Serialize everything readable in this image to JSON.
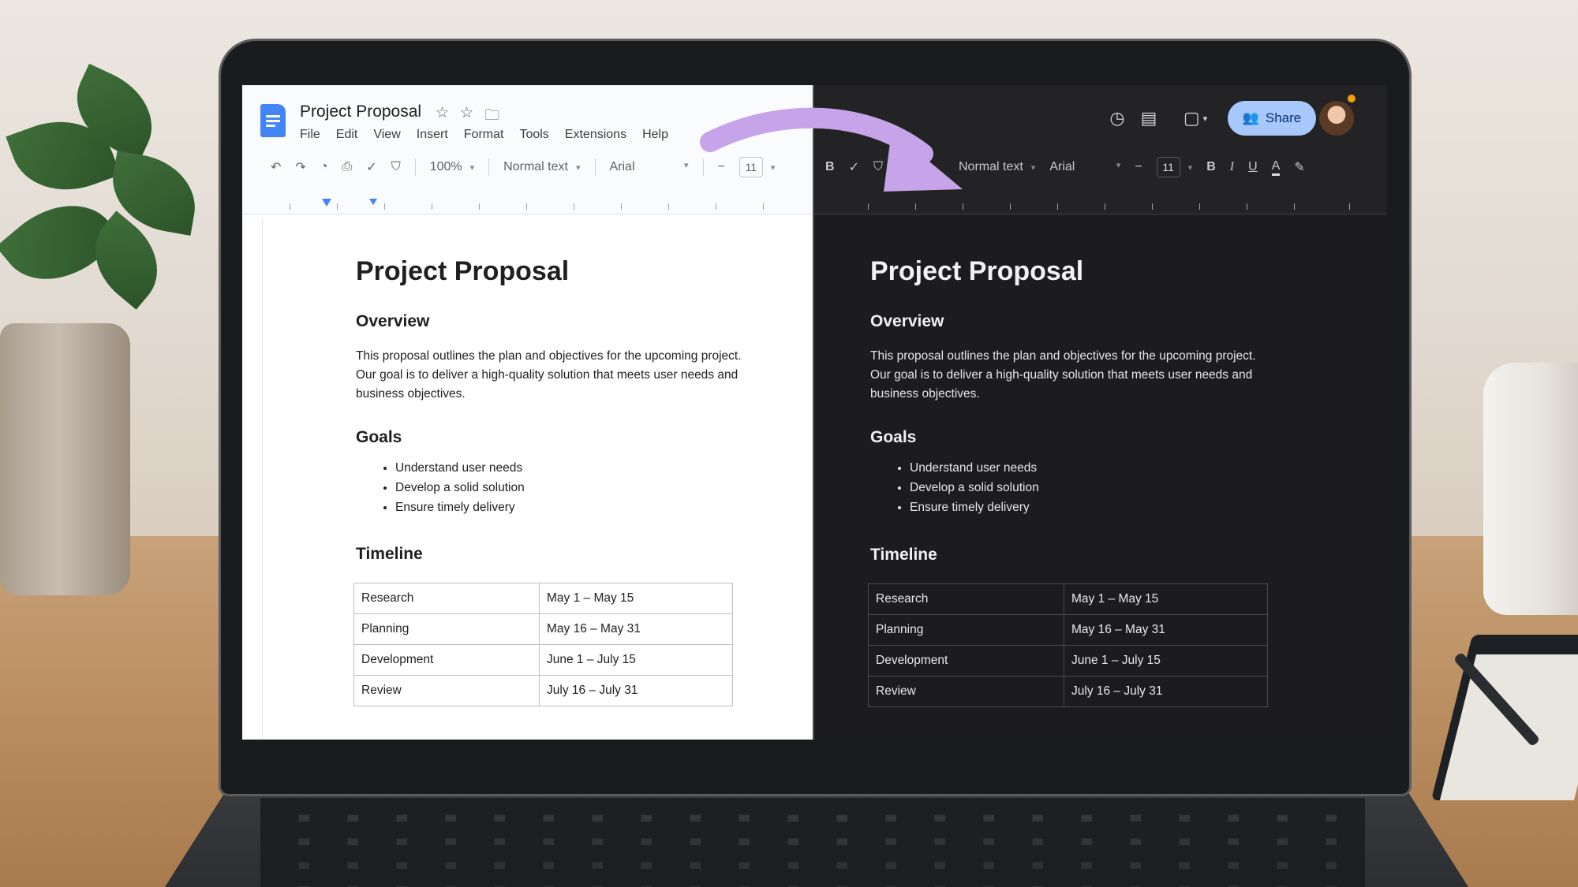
{
  "doc": {
    "title": "Project Proposal",
    "menu": [
      "File",
      "Edit",
      "View",
      "Insert",
      "Format",
      "Tools",
      "Extensions",
      "Help"
    ],
    "toolbar": {
      "zoom": "100%",
      "style": "Normal text",
      "font": "Arial",
      "font_size": "11",
      "minus": "−",
      "plus": "+",
      "bold": "B",
      "italic": "I",
      "underline": "U",
      "text_color": "A"
    },
    "share_label": "Share",
    "heading": "Project Proposal",
    "overview_heading": "Overview",
    "overview_text": "This proposal outlines the plan and objectives for the upcoming project. Our goal is to deliver a high-quality solution that meets user needs and business objectives.",
    "goals_heading": "Goals",
    "goals": [
      "Understand user needs",
      "Develop a solid solution",
      "Ensure timely delivery"
    ],
    "timeline_heading": "Timeline",
    "timeline": [
      {
        "phase": "Research",
        "dates": "May 1 – May 15"
      },
      {
        "phase": "Planning",
        "dates": "May 16 – May 31"
      },
      {
        "phase": "Development",
        "dates": "June 1 – July 15"
      },
      {
        "phase": "Review",
        "dates": "July 16 – July 31"
      }
    ]
  },
  "icons": {
    "star": "star-icon",
    "folder": "folder-icon",
    "undo": "undo-icon",
    "redo": "redo-icon",
    "print": "print-icon",
    "spellcheck": "spellcheck-icon",
    "paint_format": "paint-format-icon",
    "history": "history-icon",
    "comments": "comments-icon",
    "meet": "video-call-icon",
    "highlighter": "highlighter-icon"
  },
  "colors": {
    "share_bg": "#a8c7fa",
    "docs_blue": "#4285f4",
    "arrow": "#c7a3ea",
    "dark_bg": "#1c1c1e"
  }
}
